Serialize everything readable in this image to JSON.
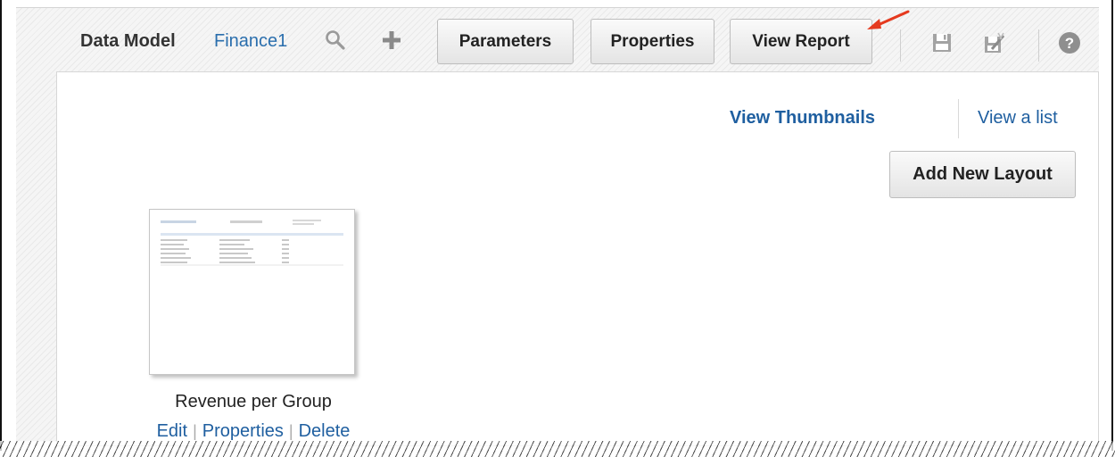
{
  "toolbar": {
    "data_model_label": "Data Model",
    "data_model_name": "Finance1",
    "parameters_label": "Parameters",
    "properties_label": "Properties",
    "view_report_label": "View Report",
    "icons": [
      "search-icon",
      "add-icon",
      "save-icon",
      "save-as-icon",
      "help-icon"
    ]
  },
  "view_toggle": {
    "thumbnails_label": "View Thumbnails",
    "list_label": "View a list"
  },
  "add_layout_label": "Add New Layout",
  "layouts": [
    {
      "name": "Revenue per Group",
      "actions": [
        "Edit",
        "Properties",
        "Delete"
      ]
    }
  ],
  "colors": {
    "link": "#1f5fa0",
    "annotation_arrow": "#e53a1f"
  }
}
